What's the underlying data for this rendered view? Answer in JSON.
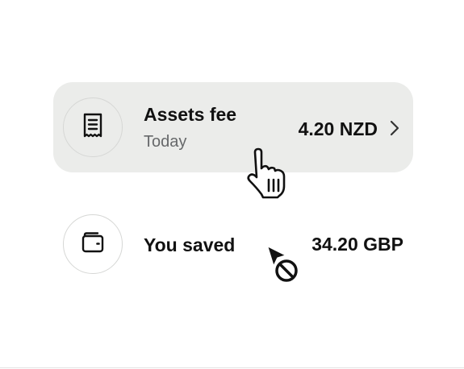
{
  "transactions": [
    {
      "icon": "receipt-icon",
      "title": "Assets fee",
      "subtitle": "Today",
      "amount": "4.20 NZD",
      "has_chevron": true,
      "highlighted": true
    },
    {
      "icon": "wallet-icon",
      "title": "You saved",
      "amount": "34.20 GBP",
      "has_chevron": false,
      "highlighted": false
    }
  ],
  "cursors": [
    {
      "icon": "hand-pointer-cursor-icon"
    },
    {
      "icon": "not-allowed-cursor-icon"
    }
  ],
  "colors": {
    "highlight_bg": "#ebecea",
    "text_primary": "#111111",
    "text_secondary": "#66686a",
    "circle_border": "#d6d7d5"
  }
}
